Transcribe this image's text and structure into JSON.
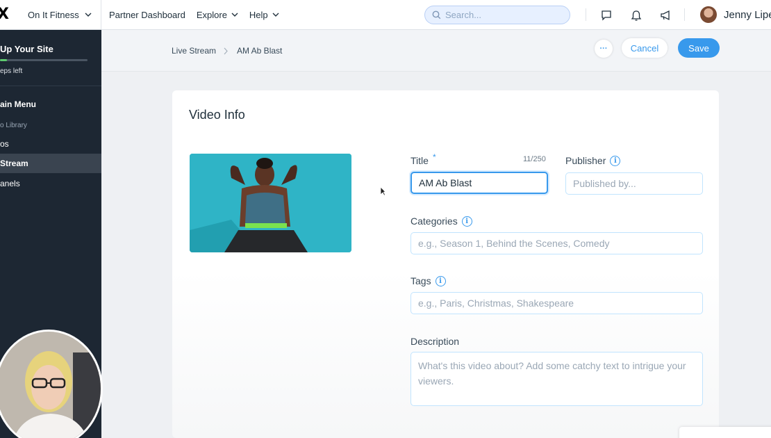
{
  "app": {
    "logo": "X",
    "site_name": "On It Fitness"
  },
  "topnav": {
    "items": [
      "Partner Dashboard",
      "Explore",
      "Help"
    ]
  },
  "search": {
    "placeholder": "Search..."
  },
  "user": {
    "name": "Jenny Lipe"
  },
  "sidebar": {
    "setup_title": "Up Your Site",
    "setup_progress": 0.08,
    "steps_left": "eps left",
    "main_menu": "ain Menu",
    "section_label": "o Library",
    "items": [
      {
        "label": "os",
        "active": false
      },
      {
        "label": "Stream",
        "active": true
      },
      {
        "label": "anels",
        "active": false
      }
    ]
  },
  "breadcrumb": {
    "parent": "Live Stream",
    "current": "AM Ab Blast"
  },
  "actions": {
    "more": "···",
    "cancel": "Cancel",
    "save": "Save"
  },
  "card": {
    "title": "Video Info",
    "fields": {
      "title": {
        "label": "Title",
        "required_mark": "*",
        "value": "AM Ab Blast",
        "counter": "11/250"
      },
      "publisher": {
        "label": "Publisher",
        "placeholder": "Published by..."
      },
      "categories": {
        "label": "Categories",
        "placeholder": "e.g., Season 1, Behind the Scenes, Comedy"
      },
      "tags": {
        "label": "Tags",
        "placeholder": "e.g., Paris, Christmas, Shakespeare"
      },
      "description": {
        "label": "Description",
        "placeholder": "What's this video about? Add some catchy text to intrigue your viewers."
      }
    }
  },
  "colors": {
    "accent": "#3899ec",
    "sidebar_bg": "#1d2733",
    "progress": "#5ecb6e"
  }
}
